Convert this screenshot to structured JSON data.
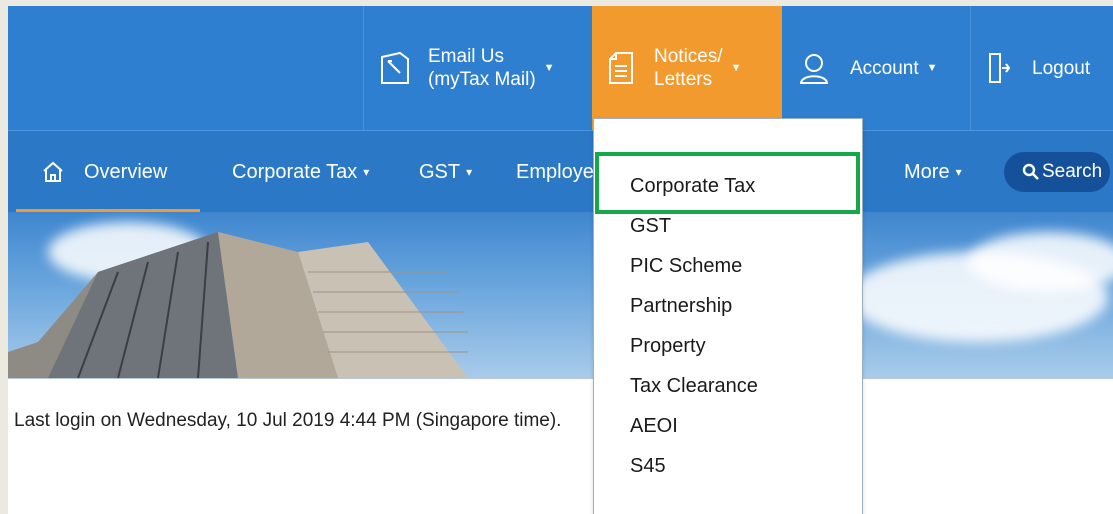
{
  "topbar": {
    "email": {
      "line1": "Email Us",
      "line2": "(myTax Mail)",
      "icon": "mail-pencil-icon"
    },
    "notices": {
      "line1": "Notices/",
      "line2": "Letters",
      "icon": "document-icon"
    },
    "account": {
      "label": "Account",
      "icon": "user-icon"
    },
    "logout": {
      "label": "Logout",
      "icon": "logout-door-icon"
    },
    "caret": "▼"
  },
  "nav": {
    "items": [
      {
        "label": "Overview",
        "icon": "home-icon"
      },
      {
        "label": "Corporate Tax"
      },
      {
        "label": "GST"
      },
      {
        "label": "Employe"
      },
      {
        "label": "More"
      }
    ],
    "caret": "▾",
    "search_label": "Search"
  },
  "dropdown": {
    "items": [
      "Corporate Tax",
      "GST",
      "PIC Scheme",
      "Partnership",
      "Property",
      "Tax Clearance",
      "AEOI",
      "S45"
    ]
  },
  "content": {
    "last_login": "Last login on Wednesday, 10 Jul 2019 4:44 PM (Singapore time)."
  },
  "colors": {
    "topbar": "#2f7fd0",
    "navbar": "#2b78c6",
    "accent_orange": "#f39a2e",
    "search_button": "#15519b",
    "highlight_green": "#14a84a"
  }
}
